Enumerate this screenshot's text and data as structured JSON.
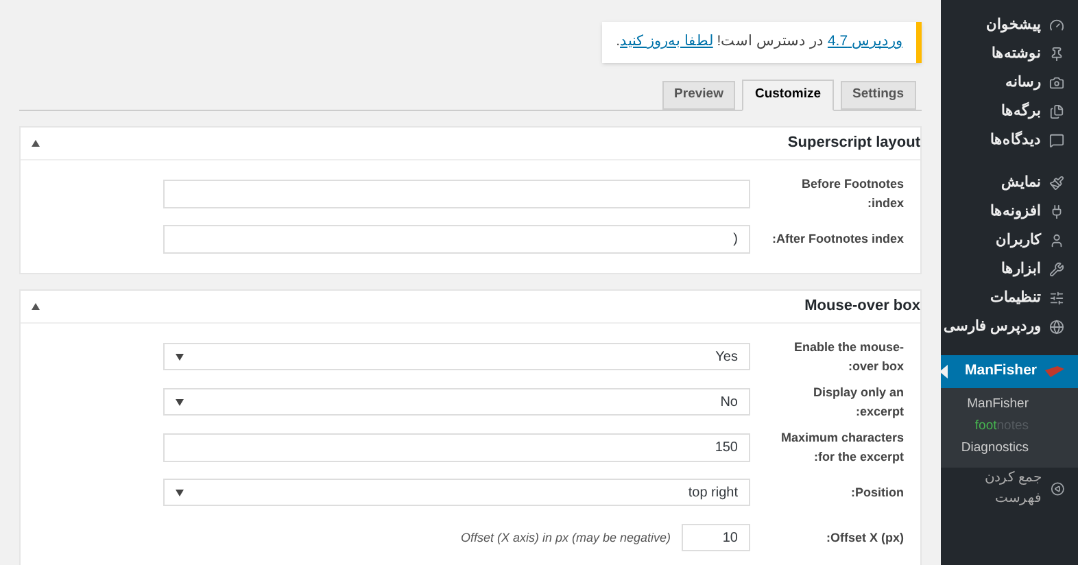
{
  "notice": {
    "link": "وردپرس 4.7",
    "text": "در دسترس است!",
    "action": "لطفا به‌روز کنید",
    "end": "."
  },
  "tabs": [
    {
      "label": "Settings",
      "selected": false
    },
    {
      "label": "Customize",
      "selected": true
    },
    {
      "label": "Preview",
      "selected": false
    }
  ],
  "panels": [
    {
      "title": "Superscript layout",
      "expanded": true,
      "rows": [
        {
          "kind": "text",
          "label": "Before Footnotes index:",
          "value": ""
        },
        {
          "kind": "text",
          "label": "After Footnotes index:",
          "value": ")"
        }
      ]
    },
    {
      "title": "Mouse-over box",
      "expanded": true,
      "rows": [
        {
          "kind": "select",
          "label": "Enable the mouse-over box:",
          "value": "Yes"
        },
        {
          "kind": "select",
          "label": "Display only an excerpt:",
          "value": "No"
        },
        {
          "kind": "text",
          "label": "Maximum characters for the excerpt:",
          "value": "150"
        },
        {
          "kind": "select",
          "label": "Position:",
          "value": "top right"
        },
        {
          "kind": "short",
          "label": "Offset X (px):",
          "value": "10",
          "hint": "Offset (X axis) in px (may be negative)"
        }
      ]
    }
  ],
  "sidebar": {
    "items": [
      {
        "label": "پیشخوان",
        "selected": false
      },
      {
        "label": "نوشته‌ها",
        "selected": false
      },
      {
        "label": "رسانه",
        "selected": false
      },
      {
        "label": "برگه‌ها",
        "selected": false
      },
      {
        "label": "دیدگاه‌ها",
        "selected": false
      },
      {
        "label": "نمایش",
        "selected": false
      },
      {
        "label": "افزونه‌ها",
        "selected": false
      },
      {
        "label": "کاربران",
        "selected": false
      },
      {
        "label": "ابزارها",
        "selected": false
      },
      {
        "label": "تنظیمات",
        "selected": false
      },
      {
        "label": "وردپرس فارسی",
        "selected": false
      },
      {
        "label": "ManFisher",
        "selected": true,
        "submenu": [
          {
            "kind": "text",
            "label": "ManFisher"
          },
          {
            "kind": "logo",
            "first": "foot",
            "second": "notes"
          },
          {
            "kind": "text",
            "label": "Diagnostics"
          }
        ]
      }
    ],
    "collapse": "جمع کردن فهرست"
  }
}
